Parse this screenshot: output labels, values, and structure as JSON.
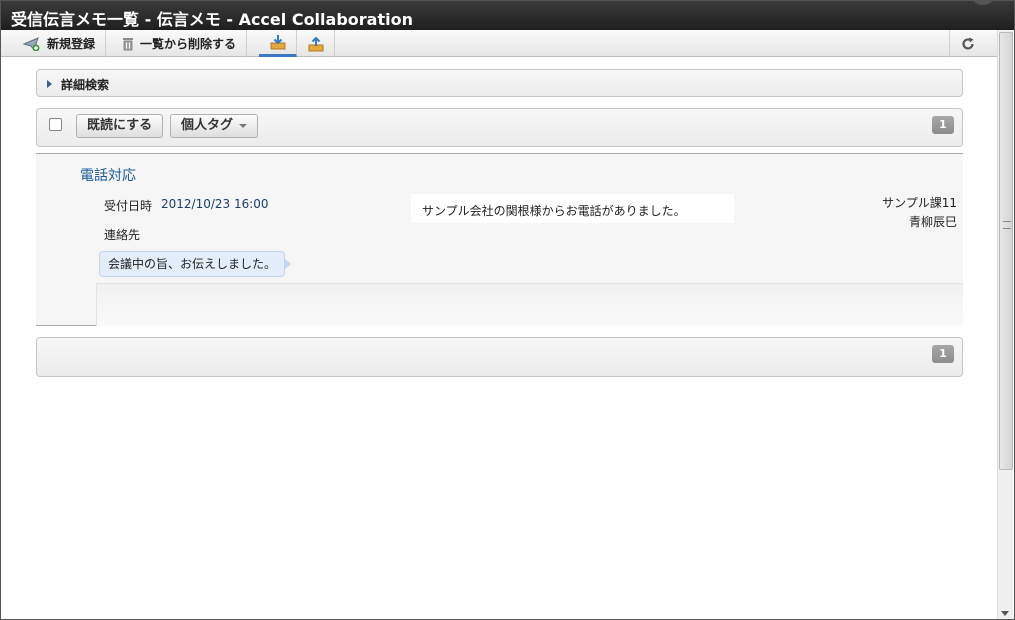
{
  "window": {
    "title": "受信伝言メモ一覧 - 伝言メモ - Accel Collaboration"
  },
  "toolbar": {
    "new_label": "新規登録",
    "delete_label": "一覧から削除する",
    "icons": [
      "paper-plane-add-icon",
      "trash-icon",
      "download-icon",
      "upload-icon",
      "refresh-icon"
    ]
  },
  "search": {
    "label": "詳細検索"
  },
  "actions": {
    "mark_read_label": "既読にする",
    "tag_label": "個人タグ"
  },
  "pagination": {
    "current_page": "1"
  },
  "memos": [
    {
      "title": "電話対応",
      "received_label": "受付日時",
      "received_value": "2012/10/23 16:00",
      "contact_label": "連絡先",
      "message": "サンプル会社の関根様からお電話がありました。",
      "sender_dept": "サンプル課11",
      "sender_name": "青柳辰巳",
      "comment": "会議中の旨、お伝えしました。"
    }
  ],
  "colors": {
    "title_bar": "#2a2a2a",
    "link": "#1a5a96",
    "active_tab": "#3b78c4",
    "comment_bg": "#e3eefa"
  }
}
